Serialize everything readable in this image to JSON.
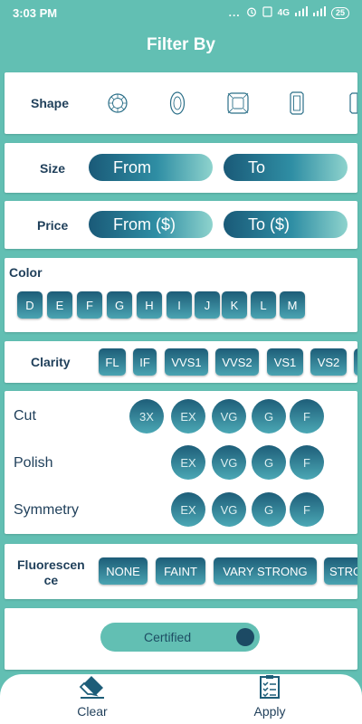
{
  "status_bar": {
    "time": "3:03 PM",
    "dots": "...",
    "network": "4G",
    "battery": "25"
  },
  "header": {
    "title": "Filter By"
  },
  "shape": {
    "label": "Shape",
    "icons": [
      "round-diamond-icon",
      "oval-diamond-icon",
      "cushion-diamond-icon",
      "emerald-diamond-icon",
      "radiant-diamond-icon"
    ]
  },
  "size": {
    "label": "Size",
    "from_placeholder": "From",
    "to_placeholder": "To"
  },
  "price": {
    "label": "Price",
    "from_placeholder": "From ($)",
    "to_placeholder": "To ($)"
  },
  "color": {
    "label": "Color",
    "options": [
      "D",
      "E",
      "F",
      "G",
      "H",
      "I",
      "J",
      "K",
      "L",
      "M"
    ]
  },
  "clarity": {
    "label": "Clarity",
    "options": [
      "FL",
      "IF",
      "VVS1",
      "VVS2",
      "VS1",
      "VS2"
    ]
  },
  "cut": {
    "label": "Cut",
    "options": [
      "3X",
      "EX",
      "VG",
      "G",
      "F"
    ]
  },
  "polish": {
    "label": "Polish",
    "options": [
      "EX",
      "VG",
      "G",
      "F"
    ]
  },
  "symmetry": {
    "label": "Symmetry",
    "options": [
      "EX",
      "VG",
      "G",
      "F"
    ]
  },
  "fluorescence": {
    "label_line1": "Fluorescen",
    "label_line2": "ce",
    "options": [
      "NONE",
      "FAINT",
      "VARY STRONG",
      "STRO"
    ]
  },
  "certified": {
    "label": "Certified"
  },
  "bottom": {
    "clear_label": "Clear",
    "apply_label": "Apply"
  },
  "colors": {
    "accent": "#62bfb3",
    "dark": "#1d5d78",
    "text": "#1f3f5a"
  }
}
